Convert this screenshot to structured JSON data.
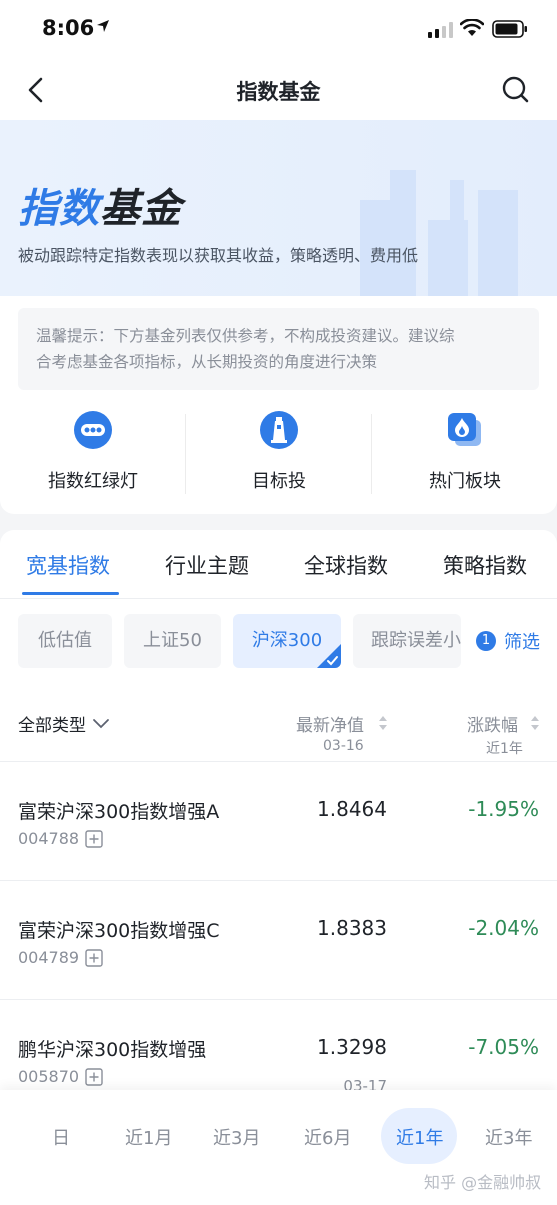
{
  "status_bar": {
    "time": "8:06"
  },
  "nav": {
    "title": "指数基金"
  },
  "banner": {
    "title_part1": "指数",
    "title_part2": "基金",
    "description": "被动跟踪特定指数表现以获取其收益，策略透明、费用低"
  },
  "tip": {
    "text_line1": "温馨提示：下方基金列表仅供参考，不构成投资建议。建议综",
    "text_line2": "合考虑基金各项指标，从长期投资的角度进行决策"
  },
  "features": [
    {
      "label": "指数红绿灯",
      "icon": "traffic-light-icon"
    },
    {
      "label": "目标投",
      "icon": "lighthouse-icon"
    },
    {
      "label": "热门板块",
      "icon": "flame-icon"
    }
  ],
  "tabs": [
    "宽基指数",
    "行业主题",
    "全球指数",
    "策略指数"
  ],
  "active_tab": 0,
  "chips": [
    "低估值",
    "上证50",
    "沪深300",
    "跟踪误差小"
  ],
  "active_chip": 2,
  "filter": {
    "count": "1",
    "label": "筛选"
  },
  "list_header": {
    "type": "全部类型",
    "nav": "最新净值",
    "nav_date": "03-16",
    "change": "涨跌幅",
    "change_period": "近1年"
  },
  "funds": [
    {
      "name": "富荣沪深300指数增强A",
      "code": "004788",
      "nav": "1.8464",
      "nav_date": "",
      "change": "-1.95%"
    },
    {
      "name": "富荣沪深300指数增强C",
      "code": "004789",
      "nav": "1.8383",
      "nav_date": "",
      "change": "-2.04%"
    },
    {
      "name": "鹏华沪深300指数增强",
      "code": "005870",
      "nav": "1.3298",
      "nav_date": "03-17",
      "change": "-7.05%"
    }
  ],
  "periods": [
    "日",
    "近1月",
    "近3月",
    "近6月",
    "近1年",
    "近3年"
  ],
  "active_period": 4,
  "watermark": "知乎 @金融帅叔",
  "colors": {
    "accent": "#2f7be6",
    "negative": "#2e8b57"
  }
}
